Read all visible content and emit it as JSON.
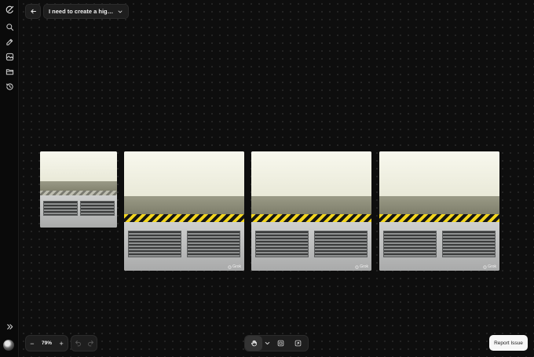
{
  "app": {
    "conversation_title": "I need to create a high res..."
  },
  "sidebar": {
    "items": [
      {
        "icon": "logo-icon"
      },
      {
        "icon": "search-icon"
      },
      {
        "icon": "edit-icon"
      },
      {
        "icon": "image-icon"
      },
      {
        "icon": "folder-icon"
      },
      {
        "icon": "history-icon"
      }
    ],
    "expand_icon": "double-chevron-right-icon"
  },
  "canvas": {
    "images": [
      {
        "watermark": ""
      },
      {
        "watermark": "Grok"
      },
      {
        "watermark": "Grok"
      },
      {
        "watermark": "Grok"
      }
    ]
  },
  "bottom_toolbar": {
    "zoom_out_label": "−",
    "zoom_level": "79%",
    "zoom_in_label": "+",
    "undo_icon": "undo-icon",
    "redo_icon": "redo-icon",
    "tools": [
      "hand-icon",
      "chevron-down-icon",
      "fit-icon",
      "export-icon"
    ]
  },
  "report_issue": {
    "label": "Report Issue"
  },
  "colors": {
    "background": "#0d0d0d",
    "panel": "#1e1e1e",
    "hazard_yellow": "#f2d51e"
  }
}
